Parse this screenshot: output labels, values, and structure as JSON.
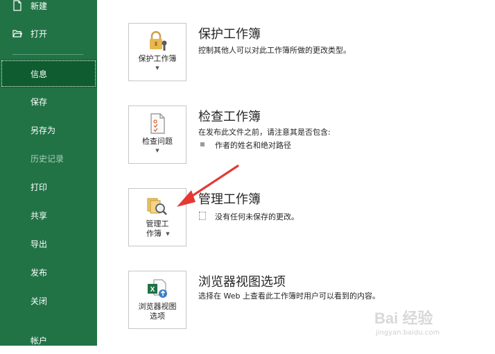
{
  "sidebar": {
    "items": [
      {
        "label": "新建",
        "icon": "new-file-icon"
      },
      {
        "label": "打开",
        "icon": "open-folder-icon"
      },
      {
        "label": "信息"
      },
      {
        "label": "保存"
      },
      {
        "label": "另存为"
      },
      {
        "label": "历史记录"
      },
      {
        "label": "打印"
      },
      {
        "label": "共享"
      },
      {
        "label": "导出"
      },
      {
        "label": "发布"
      },
      {
        "label": "关闭"
      },
      {
        "label": "帐户"
      }
    ]
  },
  "sections": [
    {
      "button_label": "保护工作簿",
      "title": "保护工作簿",
      "description": "控制其他人可以对此工作簿所做的更改类型。"
    },
    {
      "button_label": "检查问题",
      "title": "检查工作簿",
      "description": "在发布此文件之前，请注意其是否包含:",
      "bullet": "作者的姓名和绝对路径"
    },
    {
      "button_label_line1": "管理工",
      "button_label_line2": "作簿",
      "title": "管理工作簿",
      "status": "没有任何未保存的更改。"
    },
    {
      "button_label_line1": "浏览器视图",
      "button_label_line2": "选项",
      "title": "浏览器视图选项",
      "description": "选择在 Web 上查看此工作簿时用户可以看到的内容。"
    }
  ],
  "watermark": {
    "text": "Bai 经验",
    "url": "jingyan.baidu.com"
  },
  "colors": {
    "sidebar_bg": "#217346",
    "sidebar_active": "#0e5c2f",
    "arrow": "#e53935"
  }
}
